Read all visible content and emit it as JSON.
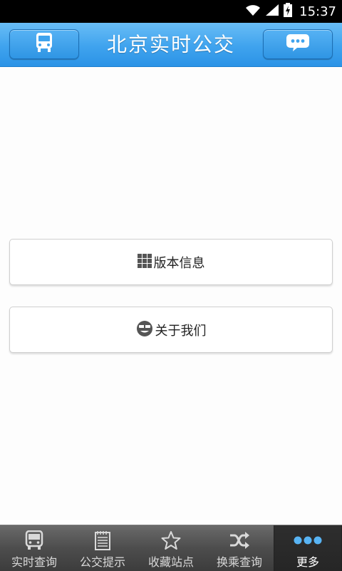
{
  "status_bar": {
    "time": "15:37",
    "icons": [
      "wifi-icon",
      "signal-icon",
      "battery-icon"
    ]
  },
  "header": {
    "title": "北京实时公交",
    "left_button_icon": "bus-icon",
    "right_button_icon": "chat-bubble-icon",
    "color": "#3fa3ee"
  },
  "menu": [
    {
      "label": "版本信息",
      "icon": "grid-icon"
    },
    {
      "label": "关于我们",
      "icon": "smiley-icon"
    }
  ],
  "tabs": [
    {
      "label": "实时查询",
      "icon": "bus-icon"
    },
    {
      "label": "公交提示",
      "icon": "notepad-icon"
    },
    {
      "label": "收藏站点",
      "icon": "star-icon"
    },
    {
      "label": "换乘查询",
      "icon": "shuffle-icon"
    },
    {
      "label": "更多",
      "icon": "more-dots-icon",
      "active": true
    }
  ]
}
